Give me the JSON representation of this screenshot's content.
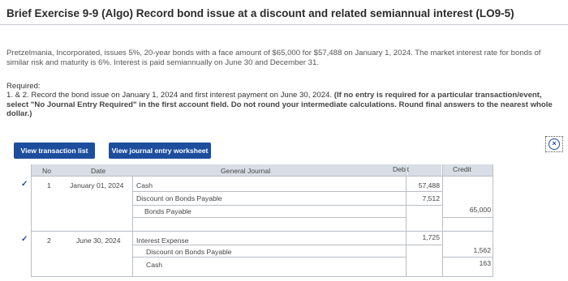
{
  "title": "Brief Exercise 9-9 (Algo) Record bond issue at a discount and related semiannual interest (LO9-5)",
  "intro_text": "Pretzelmania, Incorporated, issues 5%, 20-year bonds with a face amount of $65,000 for $57,488 on January 1, 2024. The market interest rate for bonds of similar risk and maturity is 6%. Interest is paid semiannually on June 30 and December 31.",
  "required_heading": "Required:",
  "required_text": "1. & 2. Record the bond issue on January 1, 2024 and first interest payment on June 30, 2024.",
  "required_instruction": "(If no entry is required for a particular transaction/event, select \"No Journal Entry Required\" in the first account field. Do not round your intermediate calculations. Round final answers to the nearest whole dollar.)",
  "tabs": {
    "view_transaction_list": "View transaction list",
    "view_journal_entry_worksheet": "View journal entry worksheet"
  },
  "table": {
    "headers": {
      "no": "No",
      "date": "Date",
      "general_journal": "General Journal",
      "debit": "Debit",
      "credit": "Credit"
    },
    "entries": [
      {
        "no": "1",
        "date": "January 01, 2024",
        "lines": [
          {
            "account": "Cash",
            "debit": "57,488",
            "credit": ""
          },
          {
            "account": "Discount on Bonds Payable",
            "debit": "7,512",
            "credit": ""
          },
          {
            "account": "Bonds Payable",
            "debit": "",
            "credit": "65,000"
          }
        ]
      },
      {
        "no": "2",
        "date": "June 30, 2024",
        "lines": [
          {
            "account": "Interest Expense",
            "debit": "1,725",
            "credit": ""
          },
          {
            "account": "Discount on Bonds Payable",
            "debit": "",
            "credit": "1,562"
          },
          {
            "account": "Cash",
            "debit": "",
            "credit": "163"
          }
        ]
      }
    ]
  },
  "colors": {
    "tab_blue": "#1d4e9e",
    "header_gray": "#d9dee6",
    "grid_line": "#b9bec5"
  }
}
